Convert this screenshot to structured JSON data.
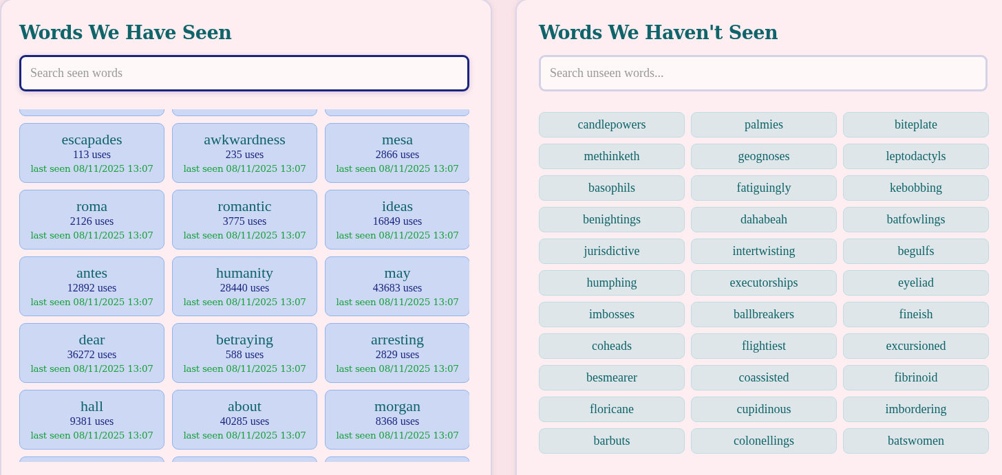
{
  "seen_panel": {
    "title": "Words We Have Seen",
    "search": {
      "placeholder": "Search seen words",
      "focused": true
    },
    "words": [
      {
        "word": "escapades",
        "uses": "113 uses",
        "last_seen": "last seen 08/11/2025 13:07"
      },
      {
        "word": "awkwardness",
        "uses": "235 uses",
        "last_seen": "last seen 08/11/2025 13:07"
      },
      {
        "word": "mesa",
        "uses": "2866 uses",
        "last_seen": "last seen 08/11/2025 13:07"
      },
      {
        "word": "roma",
        "uses": "2126 uses",
        "last_seen": "last seen 08/11/2025 13:07"
      },
      {
        "word": "romantic",
        "uses": "3775 uses",
        "last_seen": "last seen 08/11/2025 13:07"
      },
      {
        "word": "ideas",
        "uses": "16849 uses",
        "last_seen": "last seen 08/11/2025 13:07"
      },
      {
        "word": "antes",
        "uses": "12892 uses",
        "last_seen": "last seen 08/11/2025 13:07"
      },
      {
        "word": "humanity",
        "uses": "28440 uses",
        "last_seen": "last seen 08/11/2025 13:07"
      },
      {
        "word": "may",
        "uses": "43683 uses",
        "last_seen": "last seen 08/11/2025 13:07"
      },
      {
        "word": "dear",
        "uses": "36272 uses",
        "last_seen": "last seen 08/11/2025 13:07"
      },
      {
        "word": "betraying",
        "uses": "588 uses",
        "last_seen": "last seen 08/11/2025 13:07"
      },
      {
        "word": "arresting",
        "uses": "2829 uses",
        "last_seen": "last seen 08/11/2025 13:07"
      },
      {
        "word": "hall",
        "uses": "9381 uses",
        "last_seen": "last seen 08/11/2025 13:07"
      },
      {
        "word": "about",
        "uses": "40285 uses",
        "last_seen": "last seen 08/11/2025 13:07"
      },
      {
        "word": "morgan",
        "uses": "8368 uses",
        "last_seen": "last seen 08/11/2025 13:07"
      }
    ]
  },
  "unseen_panel": {
    "title": "Words We Haven't Seen",
    "search": {
      "placeholder": "Search unseen words...",
      "focused": false
    },
    "words": [
      "candlepowers",
      "palmies",
      "biteplate",
      "methinketh",
      "geognoses",
      "leptodactyls",
      "basophils",
      "fatiguingly",
      "kebobbing",
      "benightings",
      "dahabeah",
      "batfowlings",
      "jurisdictive",
      "intertwisting",
      "begulfs",
      "humphing",
      "executorships",
      "eyeliad",
      "imbosses",
      "ballbreakers",
      "fineish",
      "coheads",
      "flightiest",
      "excursioned",
      "besmearer",
      "coassisted",
      "fibrinoid",
      "floricane",
      "cupidinous",
      "imbordering",
      "barbuts",
      "colonellings",
      "batswomen"
    ]
  }
}
